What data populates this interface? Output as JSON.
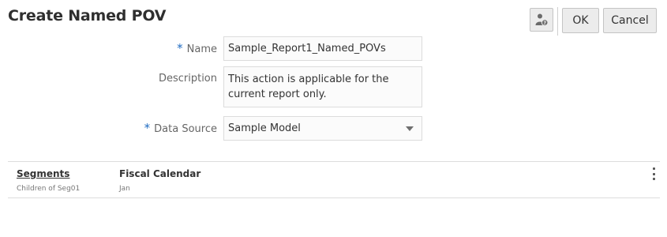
{
  "header": {
    "title": "Create Named POV",
    "ok_label": "OK",
    "cancel_label": "Cancel",
    "help_icon": "user-help-icon"
  },
  "form": {
    "name": {
      "label": "Name",
      "required": true,
      "value": "Sample_Report1_Named_POVs"
    },
    "description": {
      "label": "Description",
      "required": false,
      "value": "This action is applicable for the current report only."
    },
    "data_source": {
      "label": "Data Source",
      "required": true,
      "value": "Sample Model"
    },
    "required_marker": "*"
  },
  "pov_table": {
    "columns": [
      {
        "header": "Segments",
        "value": "Children of Seg01"
      },
      {
        "header": "Fiscal Calendar",
        "value": "Jan"
      }
    ],
    "menu_icon": "more-vertical-icon"
  },
  "colors": {
    "required_marker": "#1f6bc1",
    "button_bg": "#ececec",
    "border": "#dcdcdc"
  }
}
